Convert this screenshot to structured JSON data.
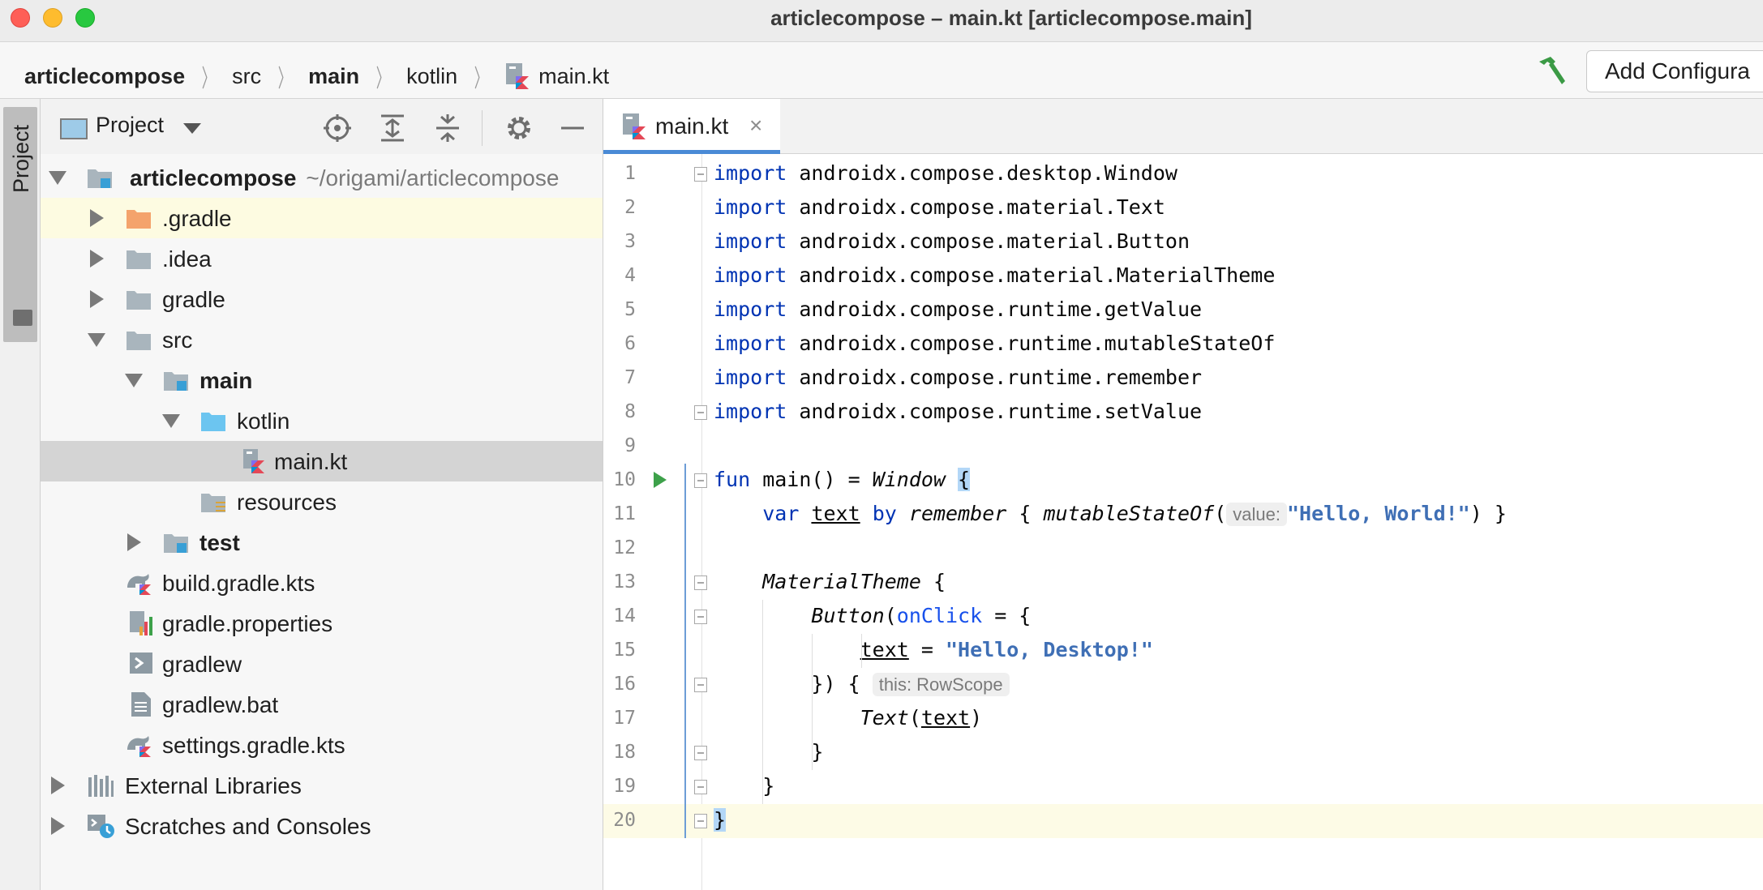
{
  "window": {
    "title": "articlecompose – main.kt [articlecompose.main]"
  },
  "breadcrumb": {
    "items": [
      "articlecompose",
      "src",
      "main",
      "kotlin",
      "main.kt"
    ],
    "separator": "〉"
  },
  "toolbar": {
    "add_config_label": "Add Configura",
    "build_icon": "hammer-icon"
  },
  "toolstrip": {
    "project_label": "Project"
  },
  "project_panel": {
    "title": "Project",
    "tree": [
      {
        "label": "articlecompose",
        "path": "~/origami/articlecompose",
        "expanded": true
      },
      {
        "label": ".gradle"
      },
      {
        "label": ".idea"
      },
      {
        "label": "gradle"
      },
      {
        "label": "src",
        "expanded": true
      },
      {
        "label": "main",
        "expanded": true
      },
      {
        "label": "kotlin",
        "expanded": true
      },
      {
        "label": "main.kt"
      },
      {
        "label": "resources"
      },
      {
        "label": "test"
      },
      {
        "label": "build.gradle.kts"
      },
      {
        "label": "gradle.properties"
      },
      {
        "label": "gradlew"
      },
      {
        "label": "gradlew.bat"
      },
      {
        "label": "settings.gradle.kts"
      },
      {
        "label": "External Libraries"
      },
      {
        "label": "Scratches and Consoles"
      }
    ]
  },
  "editor": {
    "tab_label": "main.kt",
    "tab_close": "×",
    "line_numbers": [
      "1",
      "2",
      "3",
      "4",
      "5",
      "6",
      "7",
      "8",
      "9",
      "10",
      "11",
      "12",
      "13",
      "14",
      "15",
      "16",
      "17",
      "18",
      "19",
      "20"
    ],
    "imports": [
      "androidx.compose.desktop.Window",
      "androidx.compose.material.Text",
      "androidx.compose.material.Button",
      "androidx.compose.material.MaterialTheme",
      "androidx.compose.runtime.getValue",
      "androidx.compose.runtime.mutableStateOf",
      "androidx.compose.runtime.remember",
      "androidx.compose.runtime.setValue"
    ],
    "kw_import": "import",
    "line10": {
      "kw": "fun",
      "rest": " main() = ",
      "call": "Window",
      "brace": "{"
    },
    "line11": {
      "kw1": "var",
      "var": "text",
      "kw2": "by",
      "call1": "remember",
      "call2": "mutableStateOf",
      "hint": "value:",
      "str": "\"Hello, World!\"",
      "end": ") }"
    },
    "line13": {
      "call": "MaterialTheme",
      "rest": " {"
    },
    "line14": {
      "call": "Button",
      "param": "onClick",
      "rest": " = {"
    },
    "line15": {
      "var": "text",
      "eq": " = ",
      "str": "\"Hello, Desktop!\""
    },
    "line16": {
      "code": "}) {",
      "hint": "this: RowScope"
    },
    "line17": {
      "call": "Text",
      "arg": "text"
    },
    "line18": "}",
    "line19": "}",
    "line20": "}"
  },
  "colors": {
    "keyword": "#0033b3",
    "string": "#3f6fb5",
    "current_line": "#fdfbe6",
    "tab_underline": "#4a8ad6",
    "run_gutter": "#3da14a"
  }
}
